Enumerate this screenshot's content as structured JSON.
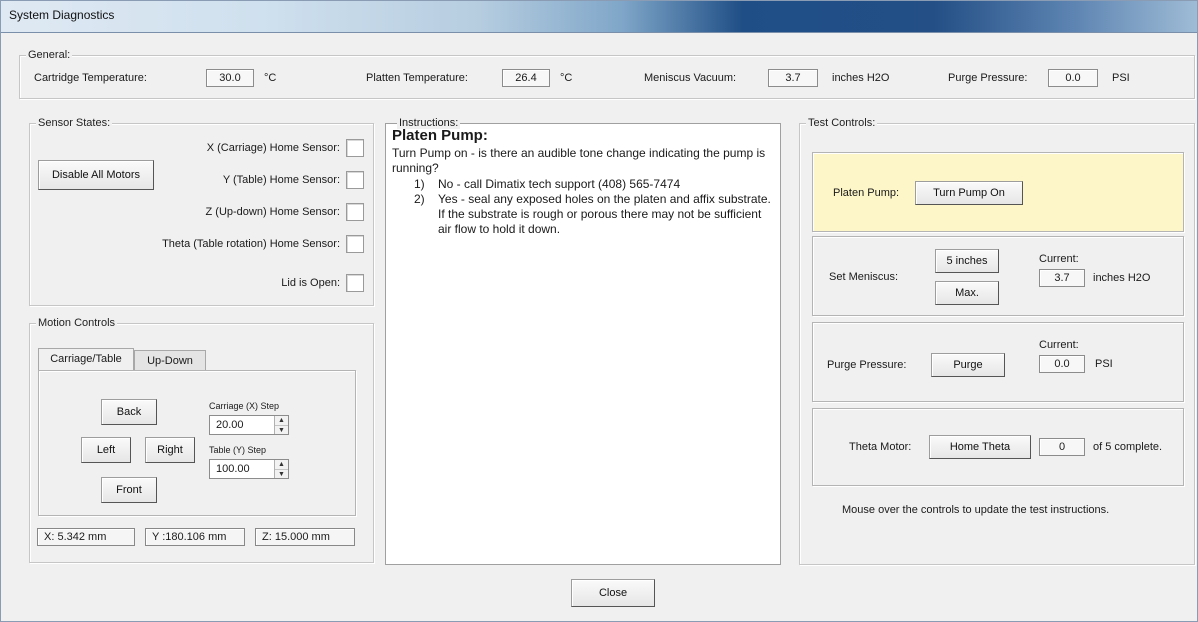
{
  "window": {
    "title": "System Diagnostics"
  },
  "general": {
    "legend": "General:",
    "cartridge_temp_label": "Cartridge Temperature:",
    "cartridge_temp_value": "30.0",
    "cartridge_temp_unit": "°C",
    "platen_temp_label": "Platten Temperature:",
    "platen_temp_value": "26.4",
    "platen_temp_unit": "°C",
    "meniscus_label": "Meniscus Vacuum:",
    "meniscus_value": "3.7",
    "meniscus_unit": "inches H2O",
    "purge_label": "Purge Pressure:",
    "purge_value": "0.0",
    "purge_unit": "PSI"
  },
  "sensors": {
    "legend": "Sensor States:",
    "disable_button": "Disable All Motors",
    "items": [
      {
        "label": "X (Carriage) Home Sensor:"
      },
      {
        "label": "Y (Table) Home Sensor:"
      },
      {
        "label": "Z (Up-down) Home Sensor:"
      },
      {
        "label": "Theta (Table rotation) Home Sensor:"
      },
      {
        "label": "Lid is Open:"
      }
    ]
  },
  "motion": {
    "legend": "Motion Controls",
    "tabs": [
      "Carriage/Table",
      "Up-Down"
    ],
    "back": "Back",
    "left": "Left",
    "right": "Right",
    "front": "Front",
    "carriage_step_label": "Carriage (X) Step",
    "carriage_step_value": "20.00",
    "table_step_label": "Table (Y) Step",
    "table_step_value": "100.00",
    "x_pos": "X: 5.342 mm",
    "y_pos": "Y :180.106 mm",
    "z_pos": "Z: 15.000 mm"
  },
  "instructions": {
    "legend": "Instructions:",
    "heading": "Platen Pump:",
    "intro": "Turn Pump on - is there an audible tone change indicating the pump is running?",
    "items": [
      {
        "num": "1)",
        "text": "No - call Dimatix tech support (408) 565-7474"
      },
      {
        "num": "2)",
        "text": "Yes - seal any exposed holes on the platen and affix substrate. If the substrate is rough or porous there may not be sufficient air flow to hold it down."
      }
    ]
  },
  "tests": {
    "legend": "Test Controls:",
    "platen_pump_label": "Platen Pump:",
    "platen_pump_button": "Turn Pump On",
    "set_meniscus_label": "Set Meniscus:",
    "meniscus_5in_button": "5 inches",
    "meniscus_max_button": "Max.",
    "meniscus_current_label": "Current:",
    "meniscus_current_value": "3.7",
    "meniscus_current_unit": "inches H2O",
    "purge_label": "Purge Pressure:",
    "purge_button": "Purge",
    "purge_current_label": "Current:",
    "purge_current_value": "0.0",
    "purge_current_unit": "PSI",
    "theta_label": "Theta Motor:",
    "theta_button": "Home Theta",
    "theta_count": "0",
    "theta_of": "of 5 complete.",
    "hint": "Mouse over the controls to update the test instructions."
  },
  "close_button": "Close",
  "colors": {
    "highlight_panel": "#fdf6c8",
    "title_blue": "#1f4e86"
  }
}
